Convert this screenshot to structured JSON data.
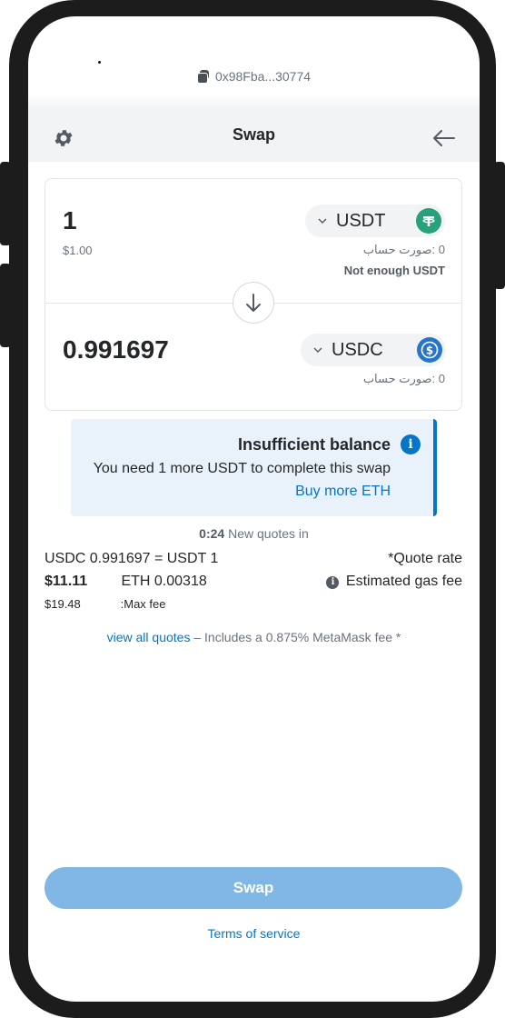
{
  "account": {
    "address": "0x98Fba...30774"
  },
  "header": {
    "title": "Swap"
  },
  "from": {
    "amount": "1",
    "fiat": "$1.00",
    "token": "USDT",
    "balance": "0 :صورت حساب",
    "warning": "Not enough USDT"
  },
  "to": {
    "amount": "0.991697",
    "token": "USDC",
    "balance": "0 :صورت حساب"
  },
  "alert": {
    "title": "Insufficient balance",
    "message": "You need 1 more USDT to complete this swap",
    "link": "Buy more ETH"
  },
  "quote": {
    "countdown": "0:24",
    "countdown_label": "New quotes in",
    "rate_value": "USDC 0.991697 = USDT 1",
    "rate_label": "*Quote rate",
    "gas_fiat": "$11.11",
    "gas_eth": "ETH 0.00318",
    "gas_label": "Estimated gas fee",
    "max_fee_fiat": "$19.48",
    "max_fee_label": ":Max fee",
    "view_all": "view all quotes",
    "fee_note": " – Includes a 0.875% MetaMask fee *"
  },
  "footer": {
    "swap_label": "Swap",
    "terms_label": "Terms of service"
  },
  "colors": {
    "accent": "#0376c9",
    "usdt": "#26a17b",
    "usdc": "#2775ca",
    "button_disabled": "#81b7e4"
  }
}
